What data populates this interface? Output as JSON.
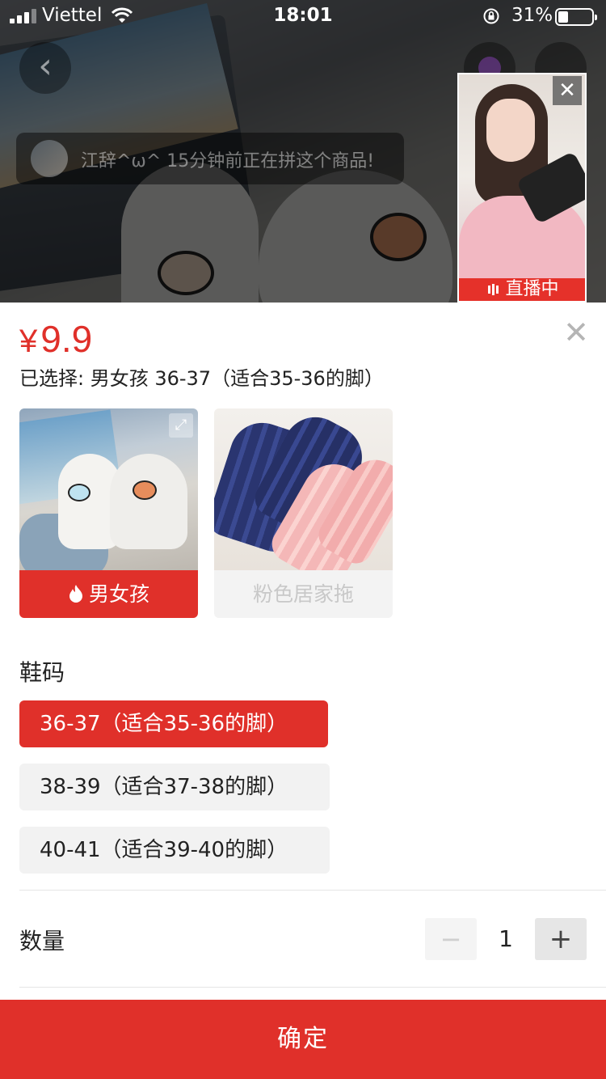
{
  "status_bar": {
    "carrier": "Viettel",
    "time": "18:01",
    "battery_percent": "31%",
    "battery_level": 0.31
  },
  "overlay": {
    "group_toast": "江辞^ω^ 15分钟前正在拼这个商品!",
    "live_label": "直播中"
  },
  "sku": {
    "currency": "¥",
    "price": "9.9",
    "selected_text": "已选择: 男女孩 36-37（适合35-36的脚）",
    "variants": [
      {
        "label": "男女孩",
        "selected": true,
        "icon": "flame-icon"
      },
      {
        "label": "粉色居家拖",
        "selected": false,
        "disabled": true
      }
    ],
    "size_title": "鞋码",
    "sizes": [
      {
        "label": "36-37（适合35-36的脚）",
        "selected": true
      },
      {
        "label": "38-39（适合37-38的脚）",
        "selected": false
      },
      {
        "label": "40-41（适合39-40的脚）",
        "selected": false
      }
    ],
    "quantity_label": "数量",
    "quantity": "1",
    "confirm_label": "确定"
  },
  "colors": {
    "accent": "#e0302a",
    "disabled_text": "#c8c8c8",
    "option_bg": "#f2f2f2"
  }
}
